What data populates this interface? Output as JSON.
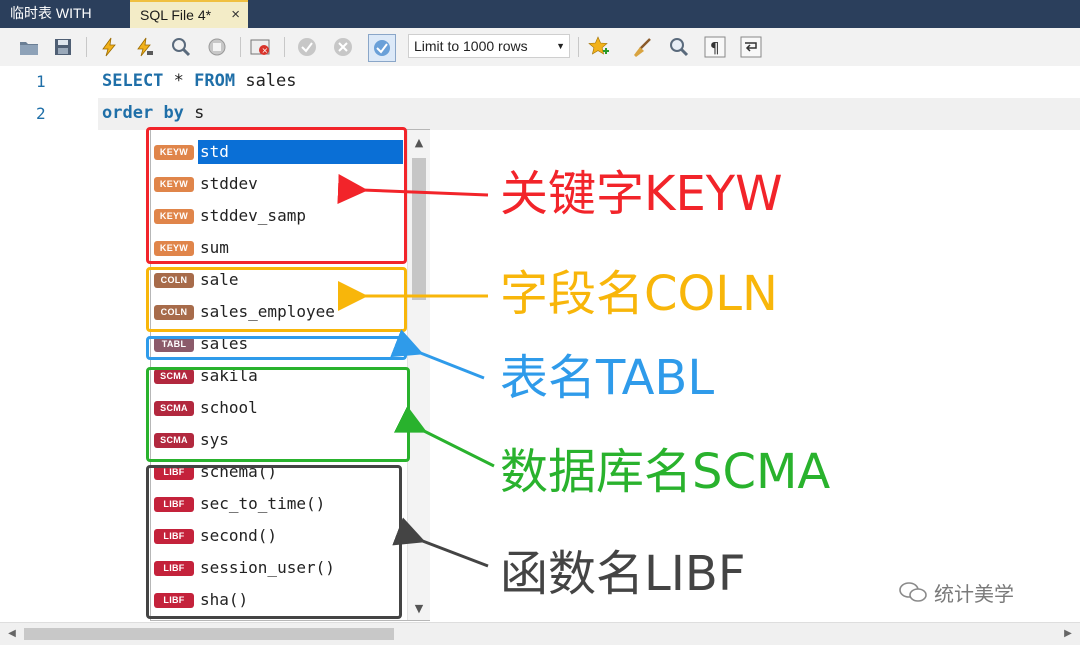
{
  "tabs": [
    {
      "label": "临时表 WITH"
    },
    {
      "label": "SQL File 4*",
      "close": "×"
    }
  ],
  "toolbar": {
    "limit_label": "Limit to 1000 rows",
    "icons": [
      "folder-open",
      "save",
      "execute",
      "execute-current",
      "explain",
      "stop",
      "toggle-error-stop",
      "commit",
      "rollback",
      "autocommit",
      "limit-rows",
      "add-snippet",
      "beautify",
      "find",
      "invisible-chars",
      "wrap-lines"
    ]
  },
  "editor": {
    "lines": [
      {
        "num": "1",
        "kw1": "SELECT",
        "mid": " * ",
        "kw2": "FROM",
        "rest": " sales"
      },
      {
        "num": "2",
        "kw1": "order",
        "mid": " ",
        "kw2": "by",
        "rest": " s"
      }
    ]
  },
  "autocomplete": {
    "items": [
      {
        "badge": "KEYW",
        "text": "std",
        "color": "#e0854a",
        "selected": true
      },
      {
        "badge": "KEYW",
        "text": "stddev",
        "color": "#e0854a"
      },
      {
        "badge": "KEYW",
        "text": "stddev_samp",
        "color": "#e0854a"
      },
      {
        "badge": "KEYW",
        "text": "sum",
        "color": "#e0854a"
      },
      {
        "badge": "COLN",
        "text": "sale",
        "color": "#a76b4a"
      },
      {
        "badge": "COLN",
        "text": "sales_employee",
        "color": "#a76b4a"
      },
      {
        "badge": "TABL",
        "text": "sales",
        "color": "#8b5a6a"
      },
      {
        "badge": "SCMA",
        "text": "sakila",
        "color": "#b2283e"
      },
      {
        "badge": "SCMA",
        "text": "school",
        "color": "#b2283e"
      },
      {
        "badge": "SCMA",
        "text": "sys",
        "color": "#b2283e"
      },
      {
        "badge": "LIBF",
        "text": "schema()",
        "color": "#c4223b"
      },
      {
        "badge": "LIBF",
        "text": "sec_to_time()",
        "color": "#c4223b"
      },
      {
        "badge": "LIBF",
        "text": "second()",
        "color": "#c4223b"
      },
      {
        "badge": "LIBF",
        "text": "session_user()",
        "color": "#c4223b"
      },
      {
        "badge": "LIBF",
        "text": "sha()",
        "color": "#c4223b"
      }
    ]
  },
  "annotations": [
    {
      "label": "关键字KEYW",
      "color": "#f2242a"
    },
    {
      "label": "字段名COLN",
      "color": "#f8b60a"
    },
    {
      "label": "表名TABL",
      "color": "#2f9bea"
    },
    {
      "label": "数据库名SCMA",
      "color": "#29b22d"
    },
    {
      "label": "函数名LIBF",
      "color": "#444444"
    }
  ],
  "watermark": {
    "text": "统计美学"
  }
}
